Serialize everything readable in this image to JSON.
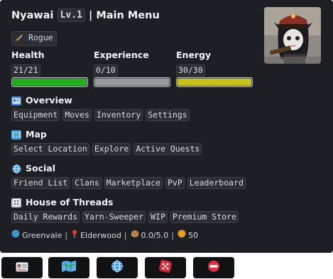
{
  "header": {
    "name": "Nyawai",
    "level": "Lv.1",
    "separator": "|",
    "title": "Main Menu",
    "role_icon": "dagger-icon",
    "role": "Rogue"
  },
  "stats": [
    {
      "label": "Health",
      "value": "21/21",
      "fill": 1.0,
      "color": "#22b01f"
    },
    {
      "label": "Experience",
      "value": "0/10",
      "fill": 1.0,
      "color": "#9a9a9a"
    },
    {
      "label": "Energy",
      "value": "30/30",
      "fill": 1.0,
      "color": "#c5c21b"
    }
  ],
  "sections": [
    {
      "icon": "id-card-icon",
      "title": "Overview",
      "items": [
        "Equipment",
        "Moves",
        "Inventory",
        "Settings"
      ]
    },
    {
      "icon": "map-icon",
      "title": "Map",
      "items": [
        "Select Location",
        "Explore",
        "Active Quests"
      ]
    },
    {
      "icon": "globe-icon",
      "title": "Social",
      "items": [
        "Friend List",
        "Clans",
        "Marketplace",
        "PvP",
        "Leaderboard"
      ]
    },
    {
      "icon": "dice-icon",
      "title": "House of Threads",
      "items": [
        "Daily Rewards",
        "Yarn-Sweeper",
        "WIP",
        "Premium Store"
      ]
    }
  ],
  "footer": {
    "region_icon": "earth-globe-icon",
    "region": "Greenvale",
    "location_icon": "pin-icon",
    "location": "Elderwood",
    "weight_icon": "box-icon",
    "weight": "0.0/5.0",
    "coins_icon": "coin-icon",
    "coins": "50"
  },
  "buttons": [
    {
      "icon": "id-card-icon"
    },
    {
      "icon": "map-icon"
    },
    {
      "icon": "globe-icon"
    },
    {
      "icon": "dice-icon"
    },
    {
      "icon": "no-entry-icon"
    }
  ]
}
